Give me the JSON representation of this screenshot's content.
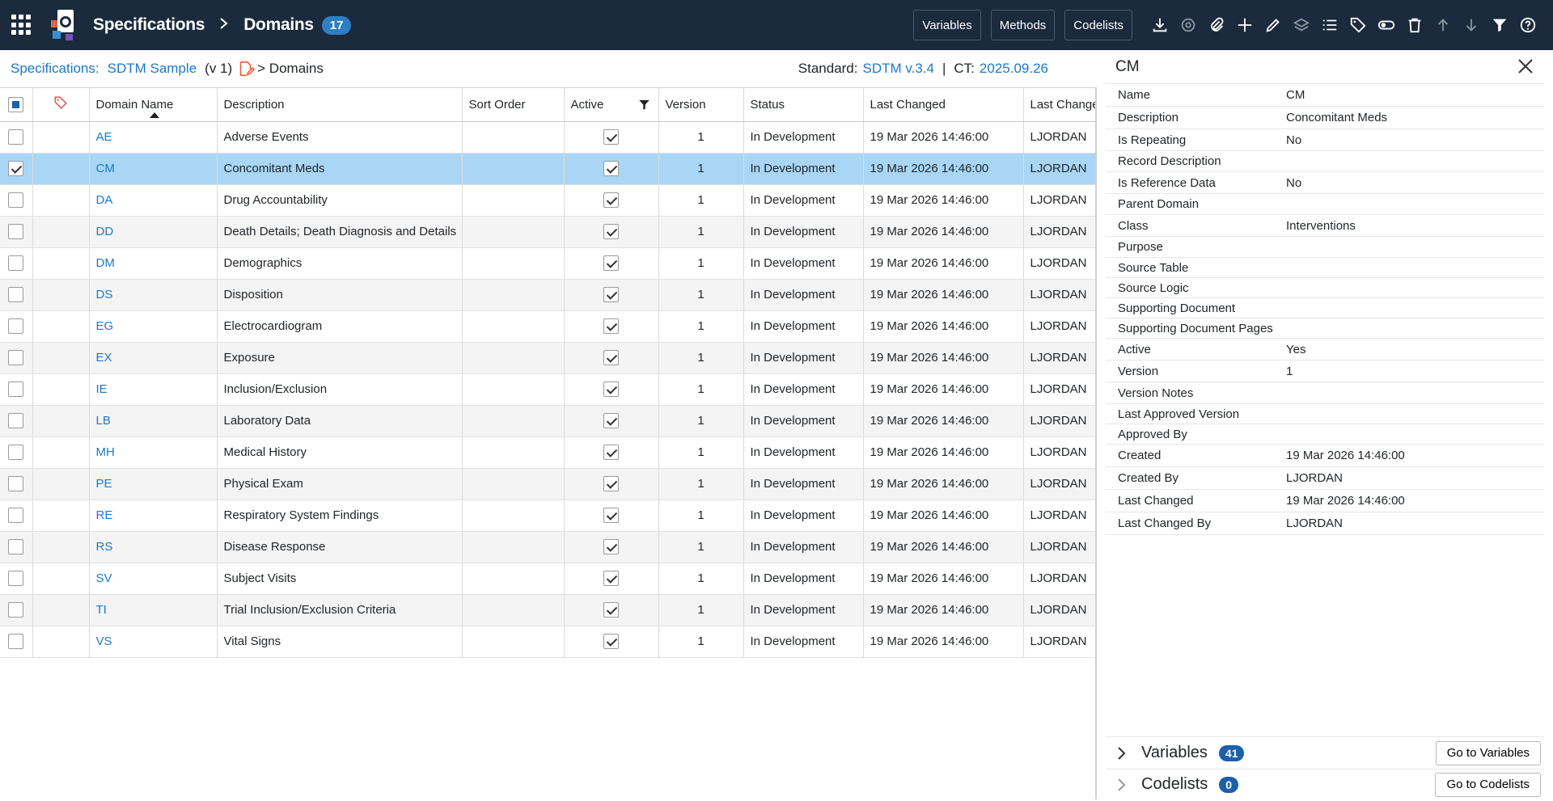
{
  "topbar": {
    "title": "Specifications",
    "current": "Domains",
    "count": "17",
    "buttons": {
      "variables": "Variables",
      "methods": "Methods",
      "codelists": "Codelists"
    }
  },
  "subheader": {
    "spec_label": "Specifications:",
    "spec_name": "SDTM Sample",
    "version": "(v 1)",
    "trail": "> Domains",
    "standard_label": "Standard:",
    "standard_value": "SDTM v.3.4",
    "sep": "|",
    "ct_label": "CT:",
    "ct_value": "2025.09.26"
  },
  "table": {
    "headers": {
      "domain_name": "Domain Name",
      "description": "Description",
      "sort_order": "Sort Order",
      "active": "Active",
      "version": "Version",
      "status": "Status",
      "last_changed": "Last Changed",
      "last_changed_by": "Last Changed By"
    },
    "rows": [
      {
        "code": "AE",
        "desc": "Adverse Events",
        "version": "1",
        "status": "In Development",
        "changed": "19 Mar 2026 14:46:00",
        "by": "LJORDAN"
      },
      {
        "code": "CM",
        "desc": "Concomitant Meds",
        "version": "1",
        "status": "In Development",
        "changed": "19 Mar 2026 14:46:00",
        "by": "LJORDAN"
      },
      {
        "code": "DA",
        "desc": "Drug Accountability",
        "version": "1",
        "status": "In Development",
        "changed": "19 Mar 2026 14:46:00",
        "by": "LJORDAN"
      },
      {
        "code": "DD",
        "desc": "Death Details; Death Diagnosis and Details",
        "version": "1",
        "status": "In Development",
        "changed": "19 Mar 2026 14:46:00",
        "by": "LJORDAN"
      },
      {
        "code": "DM",
        "desc": "Demographics",
        "version": "1",
        "status": "In Development",
        "changed": "19 Mar 2026 14:46:00",
        "by": "LJORDAN"
      },
      {
        "code": "DS",
        "desc": "Disposition",
        "version": "1",
        "status": "In Development",
        "changed": "19 Mar 2026 14:46:00",
        "by": "LJORDAN"
      },
      {
        "code": "EG",
        "desc": "Electrocardiogram",
        "version": "1",
        "status": "In Development",
        "changed": "19 Mar 2026 14:46:00",
        "by": "LJORDAN"
      },
      {
        "code": "EX",
        "desc": "Exposure",
        "version": "1",
        "status": "In Development",
        "changed": "19 Mar 2026 14:46:00",
        "by": "LJORDAN"
      },
      {
        "code": "IE",
        "desc": "Inclusion/Exclusion",
        "version": "1",
        "status": "In Development",
        "changed": "19 Mar 2026 14:46:00",
        "by": "LJORDAN"
      },
      {
        "code": "LB",
        "desc": "Laboratory Data",
        "version": "1",
        "status": "In Development",
        "changed": "19 Mar 2026 14:46:00",
        "by": "LJORDAN"
      },
      {
        "code": "MH",
        "desc": "Medical History",
        "version": "1",
        "status": "In Development",
        "changed": "19 Mar 2026 14:46:00",
        "by": "LJORDAN"
      },
      {
        "code": "PE",
        "desc": "Physical Exam",
        "version": "1",
        "status": "In Development",
        "changed": "19 Mar 2026 14:46:00",
        "by": "LJORDAN"
      },
      {
        "code": "RE",
        "desc": "Respiratory System Findings",
        "version": "1",
        "status": "In Development",
        "changed": "19 Mar 2026 14:46:00",
        "by": "LJORDAN"
      },
      {
        "code": "RS",
        "desc": "Disease Response",
        "version": "1",
        "status": "In Development",
        "changed": "19 Mar 2026 14:46:00",
        "by": "LJORDAN"
      },
      {
        "code": "SV",
        "desc": "Subject Visits",
        "version": "1",
        "status": "In Development",
        "changed": "19 Mar 2026 14:46:00",
        "by": "LJORDAN"
      },
      {
        "code": "TI",
        "desc": "Trial Inclusion/Exclusion Criteria",
        "version": "1",
        "status": "In Development",
        "changed": "19 Mar 2026 14:46:00",
        "by": "LJORDAN"
      },
      {
        "code": "VS",
        "desc": "Vital Signs",
        "version": "1",
        "status": "In Development",
        "changed": "19 Mar 2026 14:46:00",
        "by": "LJORDAN"
      }
    ],
    "selected_code": "CM"
  },
  "panel": {
    "title": "CM",
    "properties": [
      {
        "key": "Name",
        "value": "CM"
      },
      {
        "key": "Description",
        "value": "Concomitant Meds"
      },
      {
        "key": "Is Repeating",
        "value": "No"
      },
      {
        "key": "Record Description",
        "value": ""
      },
      {
        "key": "Is Reference Data",
        "value": "No"
      },
      {
        "key": "Parent Domain",
        "value": ""
      },
      {
        "key": "Class",
        "value": "Interventions"
      },
      {
        "key": "Purpose",
        "value": ""
      },
      {
        "key": "Source Table",
        "value": ""
      },
      {
        "key": "Source Logic",
        "value": ""
      },
      {
        "key": "Supporting Document",
        "value": ""
      },
      {
        "key": "Supporting Document Pages",
        "value": ""
      },
      {
        "key": "Active",
        "value": "Yes"
      },
      {
        "key": "Version",
        "value": "1"
      },
      {
        "key": "Version Notes",
        "value": ""
      },
      {
        "key": "Last Approved Version",
        "value": ""
      },
      {
        "key": "Approved By",
        "value": ""
      },
      {
        "key": "Created",
        "value": "19 Mar 2026 14:46:00"
      },
      {
        "key": "Created By",
        "value": "LJORDAN"
      },
      {
        "key": "Last Changed",
        "value": "19 Mar 2026 14:46:00"
      },
      {
        "key": "Last Changed By",
        "value": "LJORDAN"
      }
    ],
    "sections": [
      {
        "label": "Variables",
        "count": "41",
        "button": "Go to Variables"
      },
      {
        "label": "Codelists",
        "count": "0",
        "button": "Go to Codelists"
      }
    ]
  },
  "colors": {
    "topbar": "#1b2a3c",
    "link": "#1d78c9",
    "selected_row": "#a9d6f5",
    "badge": "#2d7fc4"
  }
}
